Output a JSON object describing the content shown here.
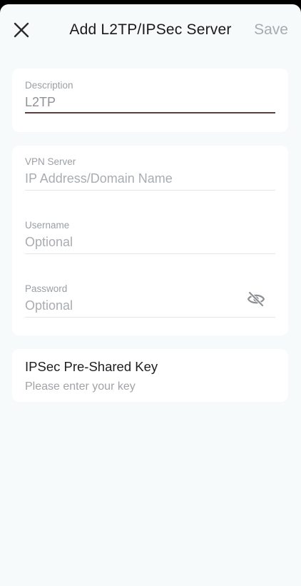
{
  "header": {
    "title": "Add L2TP/IPSec Server",
    "save_label": "Save",
    "close_icon": "close-icon"
  },
  "description_section": {
    "label": "Description",
    "value": "L2TP"
  },
  "server_section": {
    "vpn_server": {
      "label": "VPN Server",
      "placeholder": "IP Address/Domain Name"
    },
    "username": {
      "label": "Username",
      "placeholder": "Optional"
    },
    "password": {
      "label": "Password",
      "placeholder": "Optional",
      "visibility_icon": "eye-off-icon"
    }
  },
  "psk_section": {
    "title": "IPSec Pre-Shared Key",
    "subtitle": "Please enter your key"
  },
  "colors": {
    "background": "#f6fafb",
    "card": "#ffffff",
    "active_underline": "#5a3f3f",
    "muted_text": "#9ea1a5"
  }
}
